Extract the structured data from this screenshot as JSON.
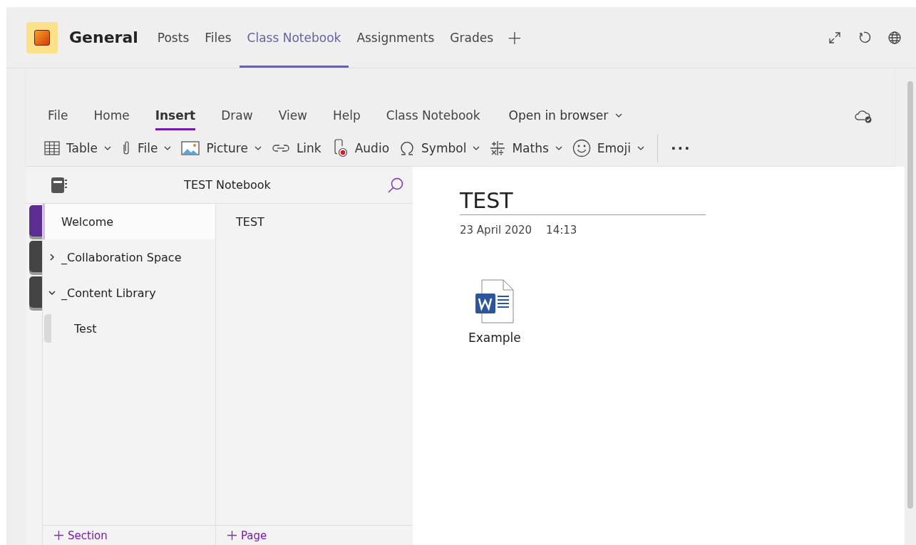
{
  "header": {
    "team": "General",
    "tabs": [
      {
        "label": "Posts",
        "selected": false
      },
      {
        "label": "Files",
        "selected": false
      },
      {
        "label": "Class Notebook",
        "selected": true
      },
      {
        "label": "Assignments",
        "selected": false
      },
      {
        "label": "Grades",
        "selected": false
      }
    ],
    "add_tab": "+"
  },
  "ribbon": {
    "tabs": [
      {
        "label": "File",
        "selected": false
      },
      {
        "label": "Home",
        "selected": false
      },
      {
        "label": "Insert",
        "selected": true
      },
      {
        "label": "Draw",
        "selected": false
      },
      {
        "label": "View",
        "selected": false
      },
      {
        "label": "Help",
        "selected": false
      },
      {
        "label": "Class Notebook",
        "selected": false
      }
    ],
    "open_in_browser": "Open in browser",
    "tools": [
      {
        "kind": "table",
        "label": "Table",
        "dropdown": true
      },
      {
        "kind": "attach",
        "label": "File",
        "dropdown": true
      },
      {
        "kind": "picture",
        "label": "Picture",
        "dropdown": true
      },
      {
        "kind": "link",
        "label": "Link",
        "dropdown": false
      },
      {
        "kind": "audio",
        "label": "Audio",
        "dropdown": false
      },
      {
        "kind": "symbol",
        "label": "Symbol",
        "dropdown": true
      },
      {
        "kind": "maths",
        "label": "Maths",
        "dropdown": true
      },
      {
        "kind": "emoji",
        "label": "Emoji",
        "dropdown": true
      }
    ],
    "more": "···"
  },
  "notebook": {
    "title": "TEST Notebook",
    "sections": [
      {
        "kind": "section",
        "label": "Welcome",
        "selected": true,
        "color": "#5c2d91"
      },
      {
        "kind": "group",
        "label": "_Collaboration Space",
        "expanded": false,
        "color": "#444444"
      },
      {
        "kind": "group",
        "label": "_Content Library",
        "expanded": true,
        "color": "#444444",
        "children": [
          {
            "label": "Test",
            "selected": false,
            "color": "#d9d9d9"
          }
        ]
      }
    ],
    "pages": [
      {
        "label": "TEST"
      }
    ],
    "add_section": "Section",
    "add_page": "Page"
  },
  "page": {
    "title": "TEST",
    "date": "23 April 2020",
    "time": "14:13",
    "attachment": {
      "kind": "word",
      "name": "Example"
    }
  }
}
